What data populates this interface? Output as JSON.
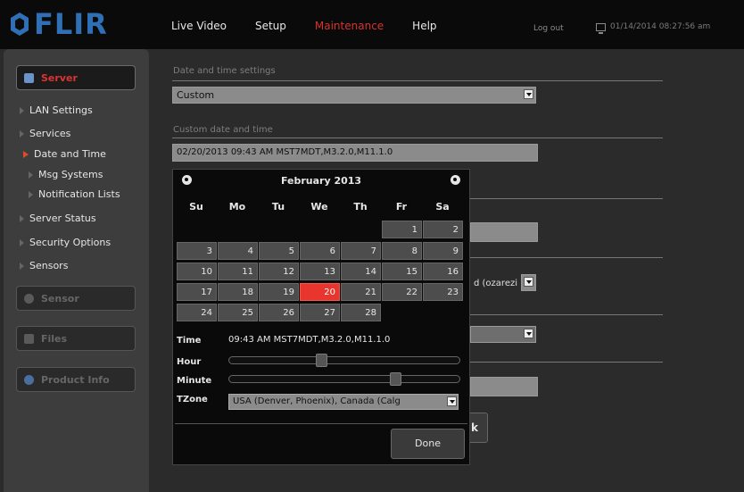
{
  "logo": {
    "text": "FLIR"
  },
  "nav": {
    "items": [
      "Live Video",
      "Setup",
      "Maintenance",
      "Help"
    ],
    "active_index": 2,
    "logout": "Log out",
    "datetime": "01/14/2014 08:27:56 am"
  },
  "sidebar": {
    "server_label": "Server",
    "items": [
      {
        "label": "LAN Settings"
      },
      {
        "label": "Services"
      },
      {
        "label": "Date and Time",
        "active": true
      },
      {
        "label": "Msg Systems"
      },
      {
        "label": "Notification Lists"
      },
      {
        "label": "Server Status"
      },
      {
        "label": "Security Options"
      },
      {
        "label": "Sensors"
      }
    ],
    "sensor_label": "Sensor",
    "files_label": "Files",
    "product_info_label": "Product Info"
  },
  "content": {
    "date_time_settings_label": "Date and time settings",
    "mode_value": "Custom",
    "custom_label": "Custom date and time",
    "custom_value": "02/20/2013 09:43 AM MST7MDT,M3.2.0,M11.1.0",
    "partial_select_text": "d (ozarezi",
    "ok_fragment": "k"
  },
  "picker": {
    "month_title": "February 2013",
    "weekdays": [
      "Su",
      "Mo",
      "Tu",
      "We",
      "Th",
      "Fr",
      "Sa"
    ],
    "weeks": [
      [
        "",
        "",
        "",
        "",
        "",
        "1",
        "2"
      ],
      [
        "3",
        "4",
        "5",
        "6",
        "7",
        "8",
        "9"
      ],
      [
        "10",
        "11",
        "12",
        "13",
        "14",
        "15",
        "16"
      ],
      [
        "17",
        "18",
        "19",
        "20",
        "21",
        "22",
        "23"
      ],
      [
        "24",
        "25",
        "26",
        "27",
        "28",
        "",
        ""
      ]
    ],
    "selected_day": "20",
    "time_label": "Time",
    "time_value": "09:43 AM MST7MDT,M3.2.0,M11.1.0",
    "hour_label": "Hour",
    "hour_value": 9,
    "minute_label": "Minute",
    "minute_value": 43,
    "tzone_label": "TZone",
    "tzone_value": "USA (Denver, Phoenix), Canada (Calg",
    "done_label": "Done"
  },
  "colors": {
    "accent_red": "#e8362e",
    "logo_blue": "#2f6fb5"
  }
}
